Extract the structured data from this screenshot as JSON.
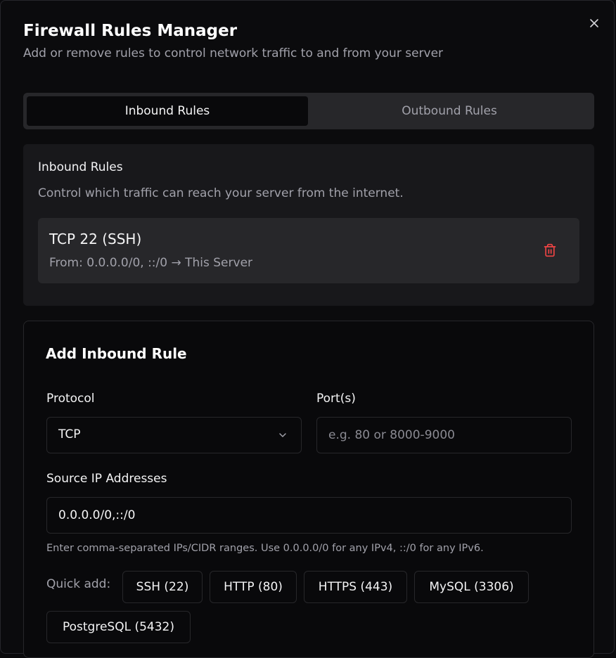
{
  "dialog": {
    "title": "Firewall Rules Manager",
    "subtitle": "Add or remove rules to control network traffic to and from your server",
    "close_icon": "close-icon"
  },
  "tabs": [
    {
      "label": "Inbound Rules",
      "active": true
    },
    {
      "label": "Outbound Rules",
      "active": false
    }
  ],
  "rules_panel": {
    "heading": "Inbound Rules",
    "description": "Control which traffic can reach your server from the internet.",
    "rules": [
      {
        "title": "TCP 22 (SSH)",
        "detail": "From: 0.0.0.0/0, ::/0 → This Server",
        "delete_icon": "trash-icon"
      }
    ]
  },
  "add_rule": {
    "title": "Add Inbound Rule",
    "protocol_label": "Protocol",
    "protocol_value": "TCP",
    "ports_label": "Port(s)",
    "ports_placeholder": "e.g. 80 or 8000-9000",
    "ports_value": "",
    "source_label": "Source IP Addresses",
    "source_value": "0.0.0.0/0,::/0",
    "source_hint": "Enter comma-separated IPs/CIDR ranges. Use 0.0.0.0/0 for any IPv4, ::/0 for any IPv6.",
    "quick_add_label": "Quick add:",
    "quick_add": [
      "SSH (22)",
      "HTTP (80)",
      "HTTPS (443)",
      "MySQL (3306)",
      "PostgreSQL (5432)"
    ]
  },
  "colors": {
    "background": "#0b0b0d",
    "panel": "#18181b",
    "card": "#27272a",
    "danger": "#ef4444",
    "muted_text": "#a1a1aa"
  }
}
